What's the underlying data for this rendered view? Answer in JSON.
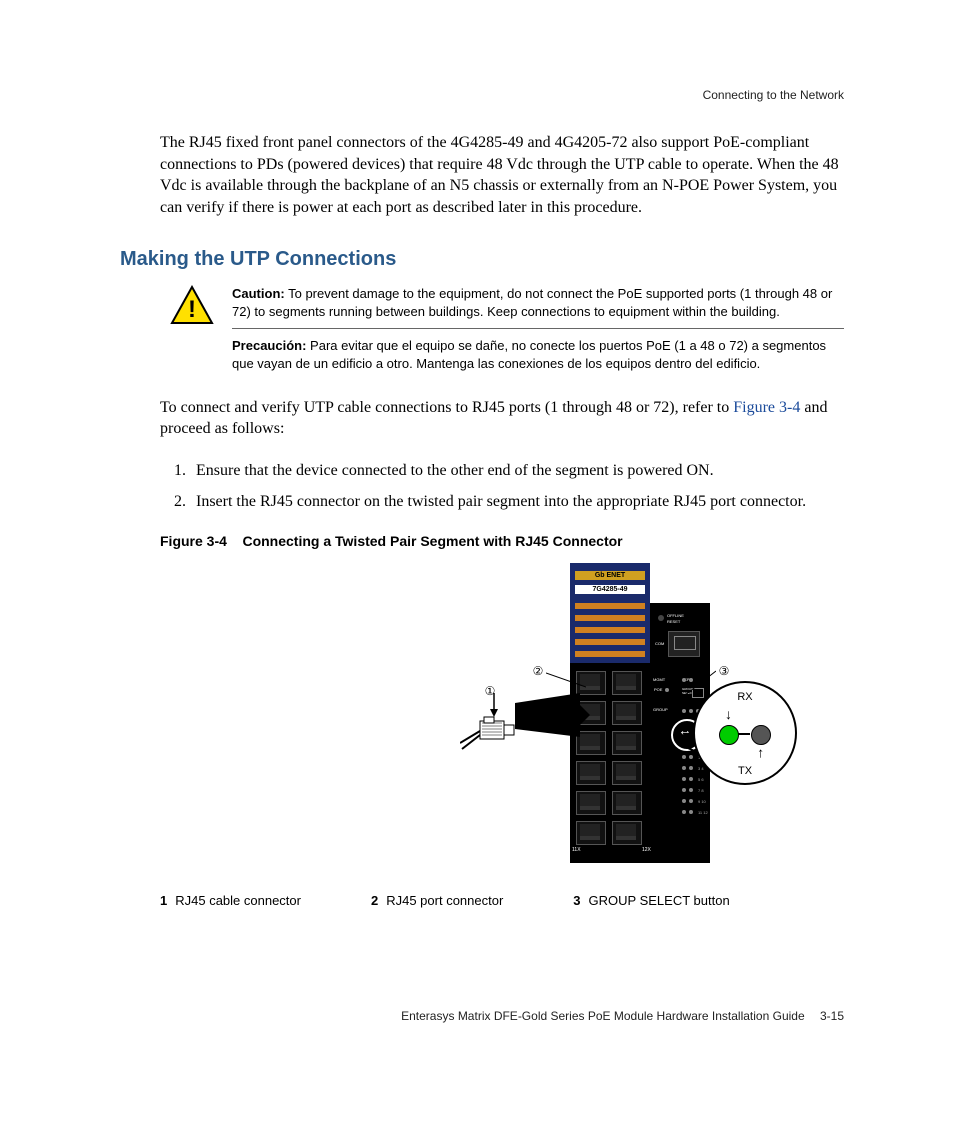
{
  "running_head": "Connecting to the Network",
  "intro_para": "The RJ45 fixed front panel connectors of the 4G4285-49 and 4G4205-72 also support PoE-compliant connections to PDs (powered devices) that require 48 Vdc through the UTP cable to operate. When the 48 Vdc is available through the backplane of an N5 chassis or externally from an N-POE Power System, you can verify if there is power at each port as described later in this procedure.",
  "section_heading": "Making the UTP Connections",
  "caution": {
    "label_en": "Caution:",
    "text_en": "To prevent damage to the equipment, do not connect the PoE supported ports (1 through 48 or 72) to segments running between buildings. Keep connections to equipment within the building.",
    "label_es": "Precaución:",
    "text_es": "Para evitar que el equipo se dañe, no conecte los puertos PoE (1 a 48 o 72) a segmentos que vayan de un edificio a otro. Mantenga las conexiones de los equipos dentro del edificio."
  },
  "lead_in_a": "To connect and verify UTP cable connections to RJ45 ports (1 through 48 or 72), refer to ",
  "figure_link": "Figure 3-4",
  "lead_in_b": " and proceed as follows:",
  "steps": [
    "Ensure that the device connected to the other end of the segment is powered ON.",
    "Insert the RJ45 connector on the twisted pair segment into the appropriate RJ45 port connector."
  ],
  "figure": {
    "number": "Figure 3-4",
    "title": "Connecting a Twisted Pair Segment with RJ45 Connector",
    "labels": {
      "gb_enet": "Gb ENET",
      "model": "7G4285-49",
      "offline": "OFFLINE",
      "reset": "RESET",
      "com": "COM",
      "mgmt": "MGMT",
      "cpu": "CPU",
      "poe": "POE",
      "group_select": "GROUP SELECT",
      "group": "GROUP",
      "port_11x": "11X",
      "port_12x": "12X",
      "rx": "RX",
      "tx": "TX",
      "callout_1": "①",
      "callout_2": "②",
      "callout_3": "③"
    },
    "legend": [
      {
        "num": "1",
        "text": "RJ45 cable connector"
      },
      {
        "num": "2",
        "text": "RJ45 port connector"
      },
      {
        "num": "3",
        "text": "GROUP SELECT button"
      }
    ]
  },
  "footer": {
    "text": "Enterasys Matrix DFE-Gold Series PoE Module Hardware Installation Guide",
    "page": "3-15"
  }
}
